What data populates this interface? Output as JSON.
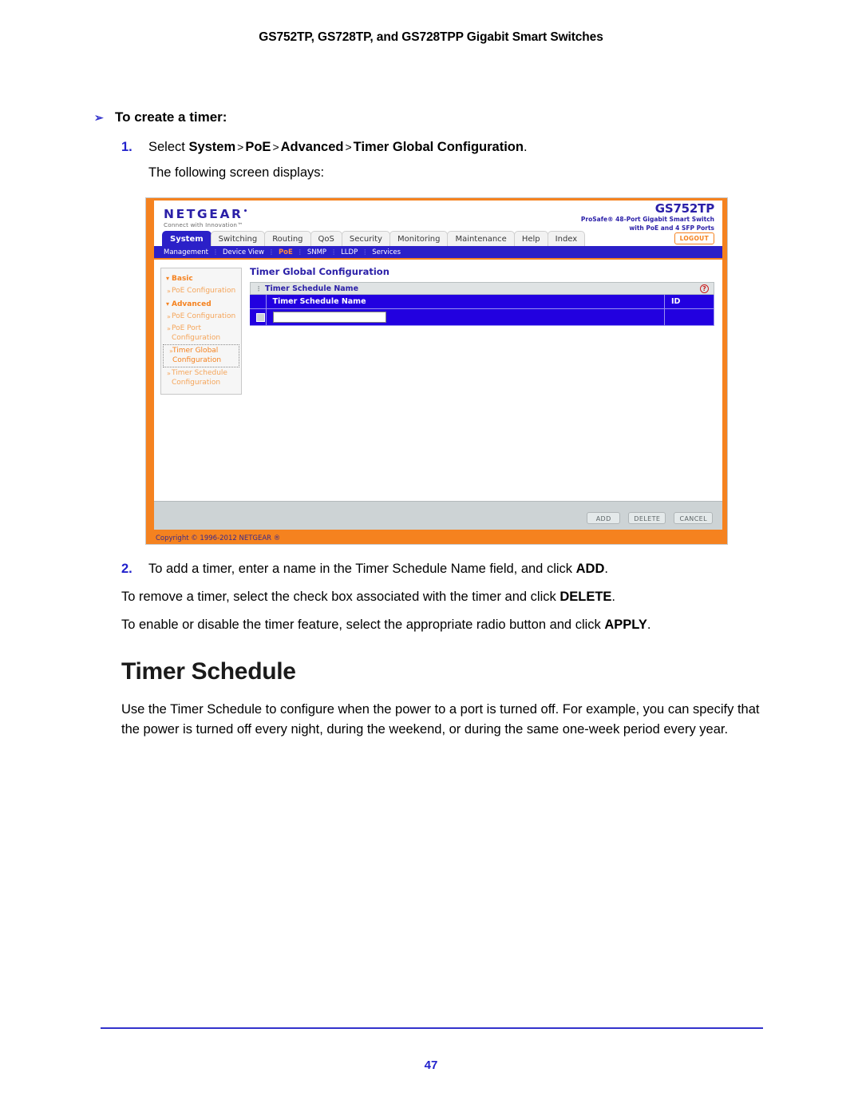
{
  "document": {
    "running_head": "GS752TP, GS728TP, and GS728TPP Gigabit Smart Switches",
    "page_number": "47",
    "procedure_heading": "To create a timer:",
    "procedure_arrow": "➢",
    "step1": {
      "number": "1.",
      "prefix": "Select ",
      "crumb1": "System",
      "sep": ">",
      "crumb2": "PoE",
      "crumb3": "Advanced",
      "crumb4": "Timer Global Configuration",
      "suffix": ".",
      "follow": "The following screen displays:"
    },
    "step2": {
      "number": "2.",
      "prefix": "To add a timer, enter a name in the Timer Schedule Name field, and click ",
      "action": "ADD",
      "suffix": "."
    },
    "para_delete": {
      "prefix": "To remove a timer, select the check box associated with the timer and click ",
      "action": "DELETE",
      "suffix": "."
    },
    "para_apply": {
      "prefix": "To enable or disable the timer feature, select the appropriate radio button and click ",
      "action": "APPLY",
      "suffix": "."
    },
    "section_title": "Timer Schedule",
    "section_body": "Use the Timer Schedule to configure when the power to a port is turned off. For example, you can specify that the power is turned off every night, during the weekend, or during the same one-week period every year."
  },
  "screenshot": {
    "brand": {
      "logo_text": "NETGEAR",
      "logo_tm": "•",
      "tagline": "Connect with Innovation™",
      "model": "GS752TP",
      "desc_line1": "ProSafe® 48-Port Gigabit Smart Switch",
      "desc_line2": "with PoE and 4 SFP Ports"
    },
    "tabs": [
      {
        "label": "System",
        "active": true
      },
      {
        "label": "Switching",
        "active": false
      },
      {
        "label": "Routing",
        "active": false
      },
      {
        "label": "QoS",
        "active": false
      },
      {
        "label": "Security",
        "active": false
      },
      {
        "label": "Monitoring",
        "active": false
      },
      {
        "label": "Maintenance",
        "active": false
      },
      {
        "label": "Help",
        "active": false
      },
      {
        "label": "Index",
        "active": false
      }
    ],
    "logout_label": "LOGOUT",
    "subnav": [
      {
        "label": "Management",
        "active": false
      },
      {
        "label": "Device View",
        "active": false
      },
      {
        "label": "PoE",
        "active": true
      },
      {
        "label": "SNMP",
        "active": false
      },
      {
        "label": "LLDP",
        "active": false
      },
      {
        "label": "Services",
        "active": false
      }
    ],
    "side_menu": [
      {
        "type": "group",
        "label": "Basic"
      },
      {
        "type": "item",
        "label": "PoE Configuration",
        "selected": false
      },
      {
        "type": "group",
        "label": "Advanced"
      },
      {
        "type": "item",
        "label": "PoE Configuration",
        "selected": false
      },
      {
        "type": "item",
        "label": "PoE Port Configuration",
        "selected": false
      },
      {
        "type": "item",
        "label": "Timer Global Configuration",
        "selected": true
      },
      {
        "type": "item",
        "label": "Timer Schedule Configuration",
        "selected": false
      }
    ],
    "content": {
      "title": "Timer Global Configuration",
      "panel_title": "Timer Schedule Name",
      "help_glyph": "?",
      "table": {
        "columns": [
          "",
          "Timer Schedule Name",
          "ID"
        ],
        "rows": [
          {
            "checkbox": true,
            "name_value": "",
            "id": ""
          }
        ]
      }
    },
    "actions": [
      "ADD",
      "DELETE",
      "CANCEL"
    ],
    "copyright": "Copyright © 1996-2012 NETGEAR ®",
    "colors": {
      "frame_orange": "#f5821f",
      "tab_blue": "#2b20c8",
      "table_blue": "#2200e0",
      "brand_purple": "#2b20a8",
      "action_bar": "#cdd3d5"
    }
  }
}
